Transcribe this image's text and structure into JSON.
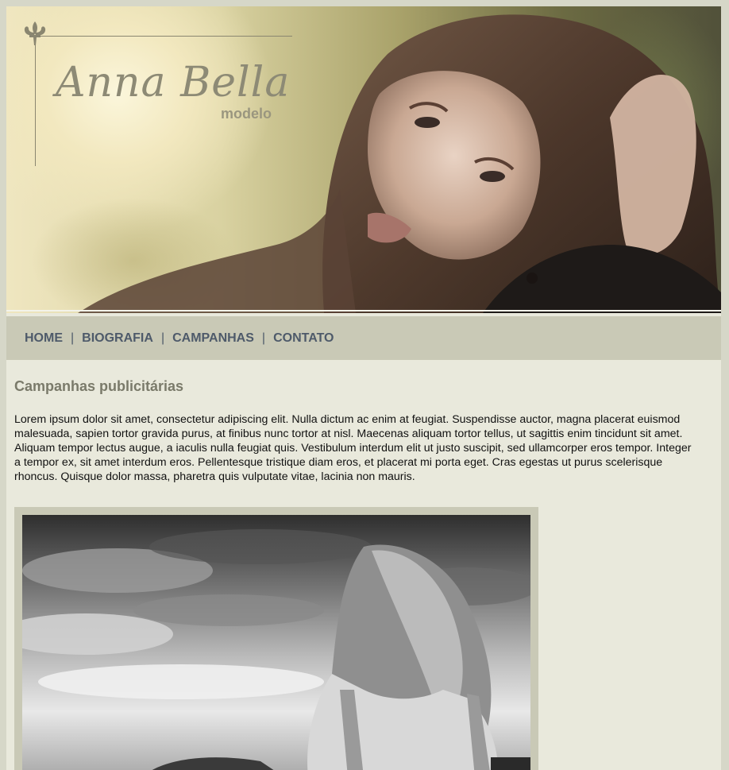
{
  "brand": {
    "name": "Anna Bella",
    "subtitle": "modelo"
  },
  "nav": {
    "items": [
      {
        "label": "HOME"
      },
      {
        "label": "BIOGRAFIA"
      },
      {
        "label": "CAMPANHAS"
      },
      {
        "label": "CONTATO"
      }
    ],
    "separator": "|"
  },
  "main": {
    "title": "Campanhas publicitárias",
    "body": "Lorem ipsum dolor sit amet, consectetur adipiscing elit. Nulla dictum ac enim at feugiat. Suspendisse auctor, magna placerat euismod malesuada, sapien tortor gravida purus, at finibus nunc tortor at nisl. Maecenas aliquam tortor tellus, ut sagittis enim tincidunt sit amet. Aliquam tempor lectus augue, a iaculis nulla feugiat quis. Vestibulum interdum elit ut justo suscipit, sed ullamcorper eros tempor. Integer a tempor ex, sit amet interdum eros. Pellentesque tristique diam eros, et placerat mi porta eget. Cras egestas ut purus scelerisque rhoncus. Quisque dolor massa, pharetra quis vulputate vitae, lacinia non mauris."
  },
  "colors": {
    "page_bg": "#e9e9dc",
    "outer_bg": "#d6d7c8",
    "nav_bg": "#c9c9b6",
    "nav_text": "#4e5a6a",
    "heading": "#7a7a6a"
  },
  "icons": {
    "logo": "fleur-de-lis-icon"
  }
}
